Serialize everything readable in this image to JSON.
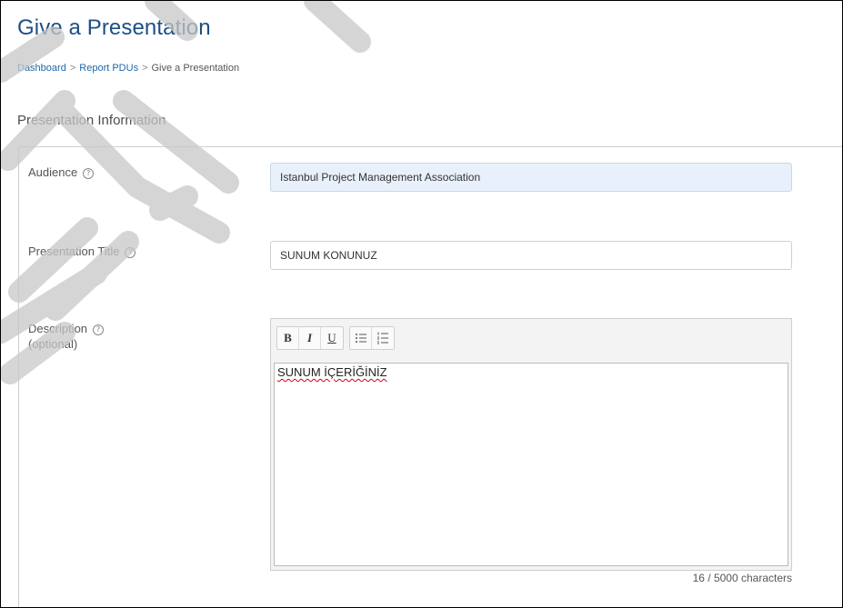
{
  "page": {
    "title": "Give a Presentation",
    "section_title": "Presentation Information"
  },
  "breadcrumb": [
    {
      "label": "Dashboard"
    },
    {
      "label": "Report PDUs"
    },
    {
      "label": "Give a Presentation"
    }
  ],
  "breadcrumb_separator": ">",
  "form": {
    "audience": {
      "label": "Audience",
      "value": "Istanbul Project Management Association"
    },
    "presentation_title": {
      "label": "Presentation Title",
      "value": "SUNUM KONUNUZ"
    },
    "description": {
      "label": "Description",
      "sublabel": "(optional)",
      "toolbar": {
        "bold": "B",
        "italic": "I",
        "underline": "U"
      },
      "value": "SUNUM İÇERİĞİNİZ",
      "counter": "16 / 5000 characters"
    },
    "help_glyph": "?"
  },
  "icons": [
    "help-icon",
    "bullet-list-icon",
    "numbered-list-icon"
  ],
  "colors": {
    "title": "#1d4f84",
    "link": "#1e67ad",
    "autofill_bg": "#e8f0fb",
    "spellcheck": "#d0021b",
    "watermark": "#c8c8c8"
  }
}
